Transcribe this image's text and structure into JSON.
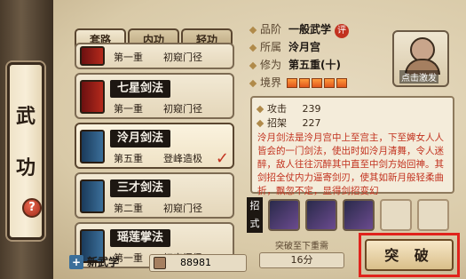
{
  "title_chars": [
    "武",
    "功"
  ],
  "help_icon": "?",
  "tabs": [
    "套路",
    "内功",
    "轻功"
  ],
  "skills": [
    {
      "name": "",
      "level": "第一重",
      "realm": "初窥门径"
    },
    {
      "name": "七星剑法",
      "level": "第一重",
      "realm": "初窥门径"
    },
    {
      "name": "泠月剑法",
      "level": "第五重",
      "realm": "登峰造极"
    },
    {
      "name": "三才剑法",
      "level": "第二重",
      "realm": "初窥门径"
    },
    {
      "name": "瑶莲掌法",
      "level": "第一重",
      "realm": "初窥门径"
    }
  ],
  "selected_skill_check": "✓",
  "info": {
    "grade_label": "品阶",
    "grade_value": "一般武学",
    "grade_eval": "评",
    "sect_label": "所属",
    "sect_value": "泠月宫",
    "cultivation_label": "修为",
    "cultivation_value": "第五重(十)",
    "realm_label": "境界",
    "realm_bars": 5
  },
  "portrait_caption": "点击激发",
  "stats": {
    "attack_label": "攻击",
    "attack_value": "239",
    "parry_label": "招架",
    "parry_value": "227",
    "description": "泠月剑法是泠月宫中上至宫主，下至婢女人人皆会的一门剑法，使出时如泠月清舞，令人迷醉，敌人往往沉醉其中直至中剑方始回神。其剑招全仗内力逼寄剑刃，使其如新月般轻柔曲折，飘忽不定，显得剑招变幻"
  },
  "moves_label": [
    "招",
    "式"
  ],
  "breakthrough": {
    "title": "突破至下重需",
    "cost": "16分",
    "button": "突 破"
  },
  "bottom": {
    "new_skill": "新武学",
    "points": "88981"
  }
}
